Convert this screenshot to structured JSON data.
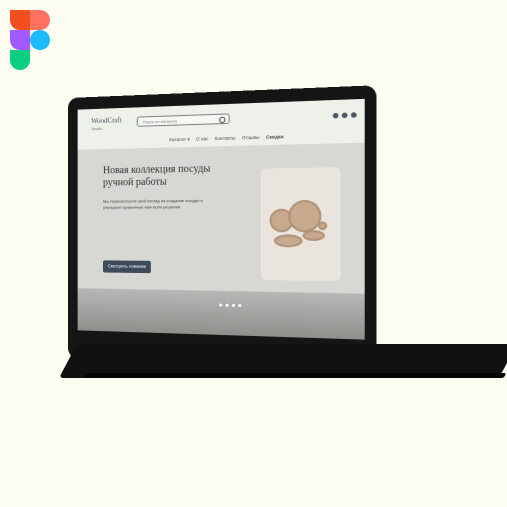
{
  "brand": {
    "name": "WoodCraft",
    "tagline": "Studio"
  },
  "search": {
    "placeholder": "Поиск по каталогу"
  },
  "nav": {
    "items": [
      "Каталог ▾",
      "О нас",
      "Контакты",
      "Отзывы",
      "Скидки"
    ]
  },
  "hero": {
    "title": "Новая коллекция посуды ручной работы",
    "text": "Мы пересмотрели свой взгляд на создание посуды и улучшили привычные нам всем решения",
    "button": "Смотреть новинки"
  },
  "colors": {
    "background": "#fdfdf2",
    "laptop": "#151515",
    "button": "#3d4a5a",
    "accent": "#c7a98d"
  }
}
